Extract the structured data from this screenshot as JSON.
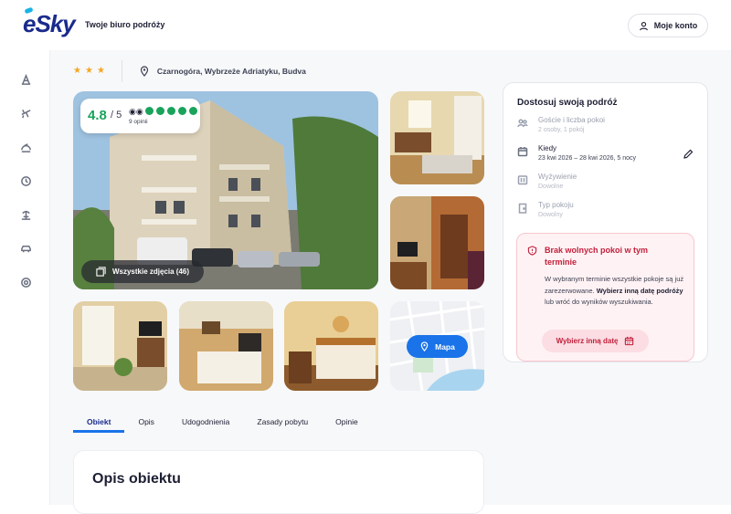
{
  "header": {
    "logo_text": "eSky",
    "tagline": "Twoje biuro podróży",
    "account_label": "Moje konto"
  },
  "sidebar": {
    "items": [
      "hotel-icon",
      "flight-icon",
      "flight-hotel-icon",
      "last-minute-icon",
      "vacation-icon",
      "car-icon",
      "support-icon"
    ]
  },
  "hotel": {
    "stars": 3,
    "location": "Czarnogóra, Wybrzeże Adriatyku, Budva",
    "rating_score": "4.8",
    "rating_max": "/ 5",
    "rating_dots": 5,
    "reviews": "9 opinii",
    "all_photos": "Wszystkie zdjęcia (46)",
    "map_label": "Mapa"
  },
  "tabs": [
    {
      "label": "Obiekt",
      "active": true
    },
    {
      "label": "Opis",
      "active": false
    },
    {
      "label": "Udogodnienia",
      "active": false
    },
    {
      "label": "Zasady pobytu",
      "active": false
    },
    {
      "label": "Opinie",
      "active": false
    }
  ],
  "section": {
    "title": "Opis obiektu"
  },
  "panel": {
    "title": "Dostosuj swoją podróż",
    "guests_label": "Goście i liczba pokoi",
    "guests_value": "2 osoby, 1 pokój",
    "when_label": "Kiedy",
    "when_value": "23 kwi 2026 – 28 kwi 2026, 5 nocy",
    "board_label": "Wyżywienie",
    "board_value": "Dowolne",
    "room_label": "Typ pokoju",
    "room_value": "Dowolny"
  },
  "alert": {
    "title": "Brak wolnych pokoi w tym terminie",
    "body_1": "W wybranym terminie wszystkie pokoje są już zarezerwowane. ",
    "body_bold": "Wybierz inną datę podróży",
    "body_2": " lub wróć do wyników wyszukiwania.",
    "button": "Wybierz inną datę"
  },
  "colors": {
    "brand": "#1a2b8c",
    "accent": "#1a73e8",
    "rating": "#19a35b",
    "alert": "#c21f3a",
    "star": "#f4a623"
  }
}
